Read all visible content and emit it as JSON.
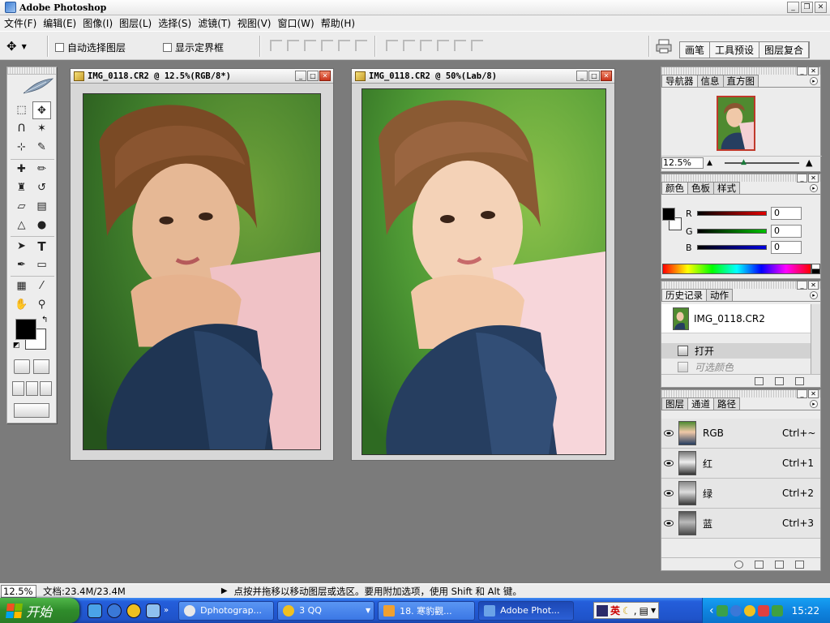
{
  "app": {
    "title": "Adobe Photoshop"
  },
  "menu": [
    "文件(F)",
    "编辑(E)",
    "图像(I)",
    "图层(L)",
    "选择(S)",
    "滤镜(T)",
    "视图(V)",
    "窗口(W)",
    "帮助(H)"
  ],
  "options": {
    "auto_select_label": "自动选择图层",
    "show_bounds_label": "显示定界框",
    "well_tabs": [
      "画笔",
      "工具预设",
      "图层复合"
    ]
  },
  "documents": [
    {
      "title": "IMG_0118.CR2 @ 12.5%(RGB/8*)",
      "version": "original"
    },
    {
      "title": "IMG_0118.CR2 @ 50%(Lab/8)",
      "version": "adjusted"
    }
  ],
  "navigator": {
    "tabs": [
      "导航器",
      "信息",
      "直方图"
    ],
    "zoom": "12.5%"
  },
  "color": {
    "tabs": [
      "颜色",
      "色板",
      "样式"
    ],
    "channels": [
      {
        "label": "R",
        "value": "0",
        "color": "#e00000"
      },
      {
        "label": "G",
        "value": "0",
        "color": "#00c000"
      },
      {
        "label": "B",
        "value": "0",
        "color": "#0000e0"
      }
    ]
  },
  "history": {
    "tabs": [
      "历史记录",
      "动作"
    ],
    "snapshot": "IMG_0118.CR2",
    "steps": [
      {
        "label": "打开",
        "state": "current"
      },
      {
        "label": "可选颜色",
        "state": "undone"
      }
    ]
  },
  "channels": {
    "tabs": [
      "图层",
      "通道",
      "路径"
    ],
    "items": [
      {
        "name": "RGB",
        "shortcut": "Ctrl+~"
      },
      {
        "name": "红",
        "shortcut": "Ctrl+1"
      },
      {
        "name": "绿",
        "shortcut": "Ctrl+2"
      },
      {
        "name": "蓝",
        "shortcut": "Ctrl+3"
      }
    ]
  },
  "status": {
    "zoom": "12.5%",
    "doc_size": "文档:23.4M/23.4M",
    "hint": "点按并拖移以移动图层或选区。要用附加选项，使用 Shift 和 Alt 键。"
  },
  "taskbar": {
    "start": "开始",
    "tasks": [
      {
        "label": "Dphotograp...",
        "icon_color": "#e8e8e8"
      },
      {
        "label": "3 QQ",
        "icon_color": "#f0c020"
      },
      {
        "label": "18. 寒豹觀...",
        "icon_color": "#f0a030"
      },
      {
        "label": "Adobe Phot...",
        "icon_color": "#6aa2e8"
      }
    ],
    "ime_label": "英",
    "clock": "15:22"
  }
}
